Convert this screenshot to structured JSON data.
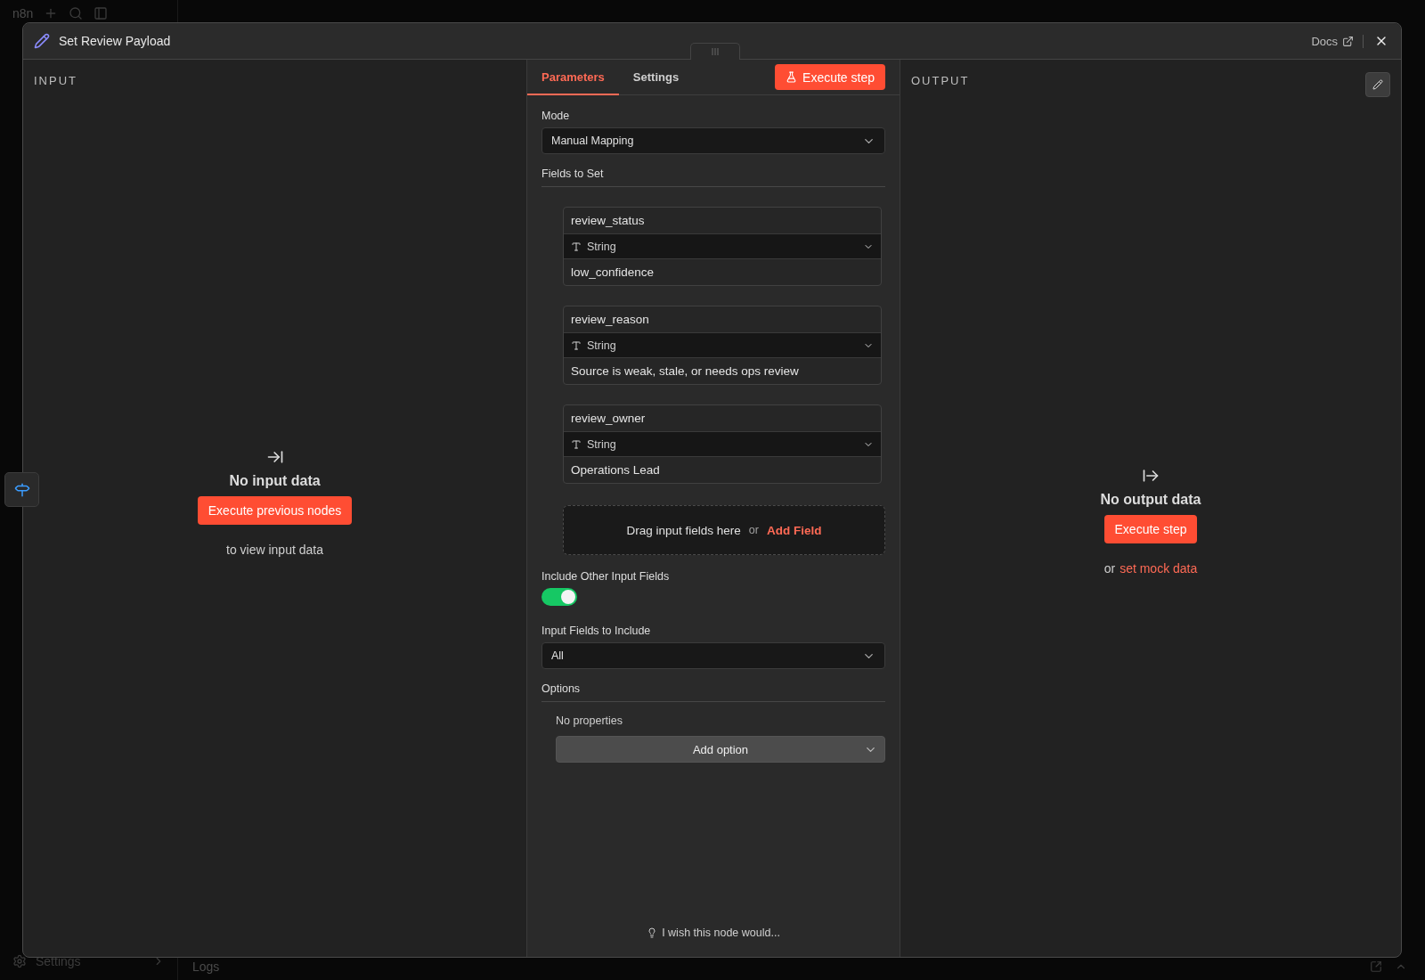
{
  "app": {
    "logo": "n8n",
    "sidebar_footer": "Settings",
    "bottom_panel": "Logs"
  },
  "modal": {
    "title": "Set Review Payload",
    "docs_link": "Docs"
  },
  "input_panel": {
    "heading": "INPUT",
    "empty_title": "No input data",
    "button": "Execute previous nodes",
    "hint": "to view input data"
  },
  "parameters": {
    "tabs": [
      {
        "label": "Parameters",
        "selected": true
      },
      {
        "label": "Settings",
        "selected": false
      }
    ],
    "execute_button": "Execute step",
    "mode": {
      "label": "Mode",
      "value": "Manual Mapping"
    },
    "fields_heading": "Fields to Set",
    "fields": [
      {
        "name": "review_status",
        "type": "String",
        "value": "low_confidence"
      },
      {
        "name": "review_reason",
        "type": "String",
        "value": "Source is weak, stale, or needs ops review"
      },
      {
        "name": "review_owner",
        "type": "String",
        "value": "Operations Lead"
      }
    ],
    "drop_zone": {
      "text": "Drag input fields here",
      "separator": "or",
      "link": "Add Field"
    },
    "include_other": {
      "label": "Include Other Input Fields",
      "on": true
    },
    "include_select": {
      "label": "Input Fields to Include",
      "value": "All"
    },
    "options": {
      "heading": "Options",
      "empty": "No properties",
      "button": "Add option"
    },
    "feedback": "I wish this node would..."
  },
  "output_panel": {
    "heading": "OUTPUT",
    "empty_title": "No output data",
    "button": "Execute step",
    "hint_prefix": "or",
    "hint_link": "set mock data"
  }
}
